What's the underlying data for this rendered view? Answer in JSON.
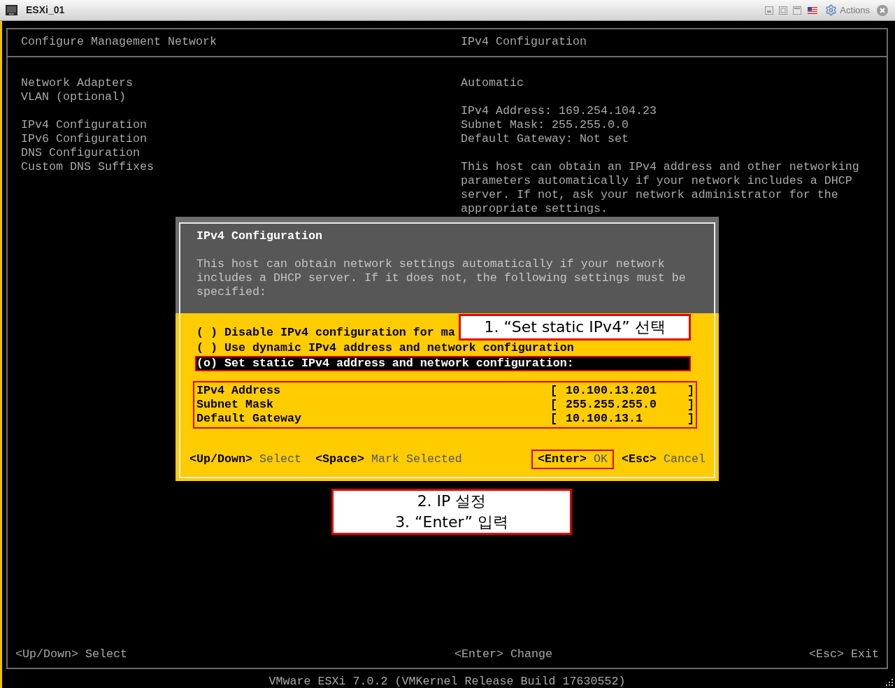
{
  "window": {
    "title": "ESXi_01",
    "actions_label": "Actions"
  },
  "screen": {
    "title": "Configure Management Network",
    "detail_title": "IPv4 Configuration"
  },
  "menu": [
    {
      "items": [
        {
          "label": "Network Adapters",
          "selected": false
        },
        {
          "label": "VLAN (optional)",
          "selected": false
        }
      ]
    },
    {
      "items": [
        {
          "label": "IPv4 Configuration",
          "selected": false
        },
        {
          "label": "IPv6 Configuration",
          "selected": false
        },
        {
          "label": "DNS Configuration",
          "selected": false
        },
        {
          "label": "Custom DNS Suffixes",
          "selected": false
        }
      ]
    }
  ],
  "details": {
    "mode": "Automatic",
    "settings": [
      "IPv4 Address: 169.254.104.23",
      "Subnet Mask: 255.255.0.0",
      "Default Gateway: Not set"
    ],
    "description": "This host can obtain an IPv4 address and other networking parameters automatically if your network includes a DHCP server. If not, ask your network administrator for the appropriate settings."
  },
  "screen_hints": [
    "<Up/Down> Select",
    "<Enter> Change",
    "<Esc> Exit"
  ],
  "dialog": {
    "title": "IPv4 Configuration",
    "description": "This host can obtain network settings automatically if your network includes a DHCP server. If it does not, the following settings must be specified:",
    "options": [
      {
        "label": "( ) Disable IPv4 configuration for ma",
        "selected": false,
        "highlighted": false
      },
      {
        "label": "( ) Use dynamic IPv4 address and network configuration",
        "selected": false,
        "highlighted": false
      },
      {
        "label": "(o) Set static IPv4 address and network configuration:",
        "selected": true,
        "highlighted": true
      }
    ],
    "fields_highlighted": true,
    "fields": [
      {
        "label": "IPv4 Address",
        "value": "10.100.13.201"
      },
      {
        "label": "Subnet Mask",
        "value": "255.255.255.0"
      },
      {
        "label": "Default Gateway",
        "value": "10.100.13.1"
      }
    ],
    "hints": [
      {
        "key": "<Up/Down>",
        "action": "Select",
        "highlighted": false
      },
      {
        "key": "<Space>",
        "action": "Mark Selected",
        "highlighted": false
      },
      {
        "key": "<Enter>",
        "action": "OK",
        "highlighted": true
      },
      {
        "key": "<Esc>",
        "action": "Cancel",
        "highlighted": false
      }
    ]
  },
  "callouts": [
    {
      "lines": [
        "1. “Set static IPv4” 선택"
      ]
    },
    {
      "lines": [
        "2. IP 설정",
        "3. “Enter” 입력"
      ]
    }
  ],
  "version": "VMware ESXi 7.0.2 (VMKernel Release Build 17630552)"
}
